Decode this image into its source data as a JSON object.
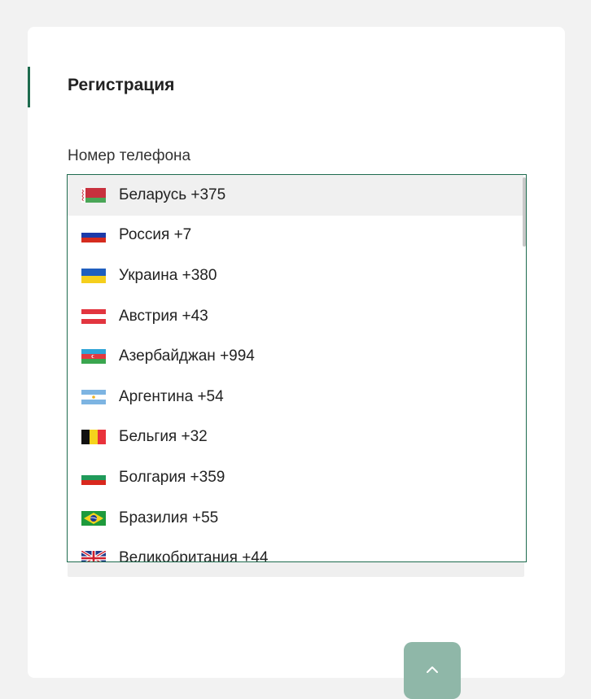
{
  "form": {
    "title": "Регистрация",
    "phone_label": "Номер телефона"
  },
  "countries": [
    {
      "label": "Беларусь +375",
      "flag": "belarus-flag-icon"
    },
    {
      "label": "Россия +7",
      "flag": "russia-flag-icon"
    },
    {
      "label": "Украина +380",
      "flag": "ukraine-flag-icon"
    },
    {
      "label": "Австрия +43",
      "flag": "austria-flag-icon"
    },
    {
      "label": "Азербайджан +994",
      "flag": "azerbaijan-flag-icon"
    },
    {
      "label": "Аргентина +54",
      "flag": "argentina-flag-icon"
    },
    {
      "label": "Бельгия +32",
      "flag": "belgium-flag-icon"
    },
    {
      "label": "Болгария +359",
      "flag": "bulgaria-flag-icon"
    },
    {
      "label": "Бразилия +55",
      "flag": "brazil-flag-icon"
    },
    {
      "label": "Великобритания +44",
      "flag": "uk-flag-icon"
    }
  ],
  "highlighted_index": 0,
  "colors": {
    "accent": "#1e6b4e",
    "scroll_top_button": "#8fb7a8",
    "page_background": "#f2f2f2"
  },
  "scroll_top_icon": "chevron-up-icon"
}
